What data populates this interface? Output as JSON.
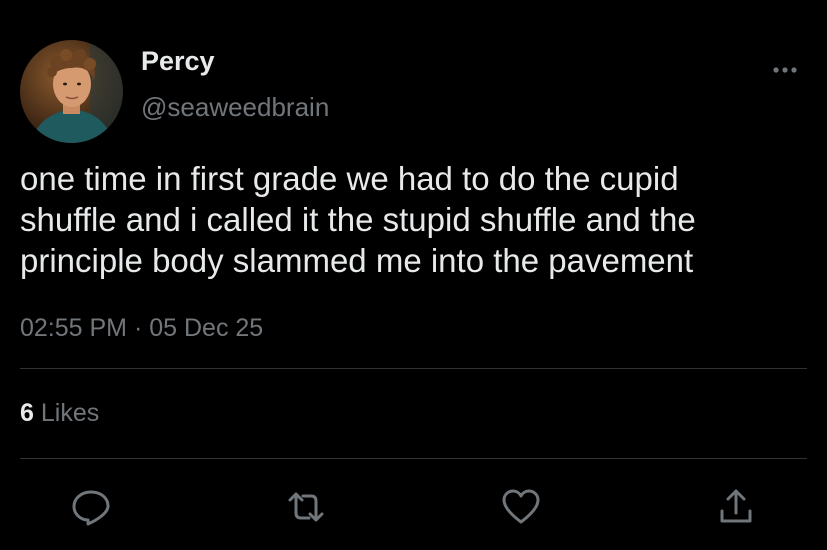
{
  "user": {
    "display_name": "Percy",
    "handle": "@seaweedbrain"
  },
  "tweet": {
    "text": "one time in first grade we had to do the cupid\nshuffle and i called it the stupid shuffle and the\nprinciple body slammed me into the pavement",
    "time": "02:55 PM",
    "separator": "·",
    "date": "05 Dec 25"
  },
  "stats": {
    "likes_count": "6",
    "likes_label": "Likes"
  },
  "icons": {
    "more": "more-horizontal-icon",
    "reply": "reply-icon",
    "retweet": "retweet-icon",
    "like": "heart-icon",
    "share": "share-icon"
  },
  "colors": {
    "background": "#000000",
    "primary_text": "#e7e9ea",
    "secondary_text": "#71767b",
    "divider": "#2f3336"
  }
}
